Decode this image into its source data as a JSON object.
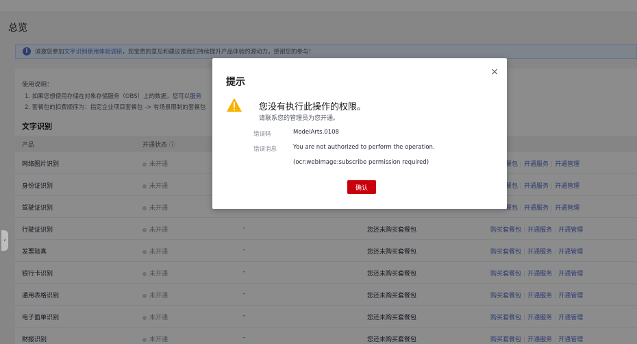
{
  "page": {
    "title": "总览"
  },
  "notice": {
    "prefix": "诚邀您参加",
    "link": "文字识别使用体验调研",
    "suffix": "，您宝贵的意见和建议是我们持续提升产品体验的源动力，感谢您的参与！"
  },
  "usage": {
    "title": "使用说明：",
    "line1_text": "1. 如果您想使用存储在对象存储服务（OBS）上的数据，您可以",
    "line1_link": "服务",
    "line2_text": "2. 套餐包的扣费顺序为：指定企业项目套餐包 -> 有场景限制的套餐包"
  },
  "section_title": "文字识别",
  "table": {
    "headers": {
      "product": "产品",
      "status": "开通状态 ⓘ"
    },
    "rows": [
      {
        "product": "网络图片识别",
        "status": "未开通",
        "col3": "",
        "col4": "",
        "actions": [
          "购买套餐包",
          "开通服务",
          "开通管理"
        ],
        "partial": true
      },
      {
        "product": "身份证识别",
        "status": "未开通",
        "col3": "",
        "col4": "",
        "actions": [
          "购买套餐包",
          "开通服务",
          "开通管理"
        ],
        "partial": true
      },
      {
        "product": "驾驶证识别",
        "status": "未开通",
        "col3": "",
        "col4": "",
        "actions": [
          "购买套餐包",
          "开通服务",
          "开通管理"
        ],
        "partial": true
      },
      {
        "product": "行驶证识别",
        "status": "未开通",
        "col3": "-",
        "col4": "您还未购买套餐包",
        "actions": [
          "购买套餐包",
          "开通服务",
          "开通管理"
        ]
      },
      {
        "product": "发票验真",
        "status": "未开通",
        "col3": "-",
        "col4": "您还未购买套餐包",
        "actions": [
          "购买套餐包",
          "开通服务",
          "开通管理"
        ]
      },
      {
        "product": "银行卡识别",
        "status": "未开通",
        "col3": "-",
        "col4": "您还未购买套餐包",
        "actions": [
          "购买套餐包",
          "开通服务",
          "开通管理"
        ]
      },
      {
        "product": "通用表格识别",
        "status": "未开通",
        "col3": "-",
        "col4": "您还未购买套餐包",
        "actions": [
          "购买套餐包",
          "开通服务",
          "开通管理"
        ]
      },
      {
        "product": "电子面单识别",
        "status": "未开通",
        "col3": "-",
        "col4": "您还未购买套餐包",
        "actions": [
          "购买套餐包",
          "开通服务",
          "开通管理"
        ]
      },
      {
        "product": "财报识别",
        "status": "未开通",
        "col3": "-",
        "col4": "您还未购买套餐包",
        "actions": [
          "购买套餐包",
          "开通服务",
          "开通管理"
        ]
      }
    ]
  },
  "dialog": {
    "title": "提示",
    "close": "×",
    "main": "您没有执行此操作的权限。",
    "sub": "请联系您的管理员为您开通。",
    "code_label": "错误码",
    "code_value": "ModelArts.0108",
    "msg_label": "错误消息",
    "msg_value": "You are not authorized to perform the operation. (ocr:webImage:subscribe permission required)",
    "confirm": "确认",
    "warn_color": "#f8b300",
    "confirm_color": "#c7000b"
  },
  "side_handle": "‹"
}
